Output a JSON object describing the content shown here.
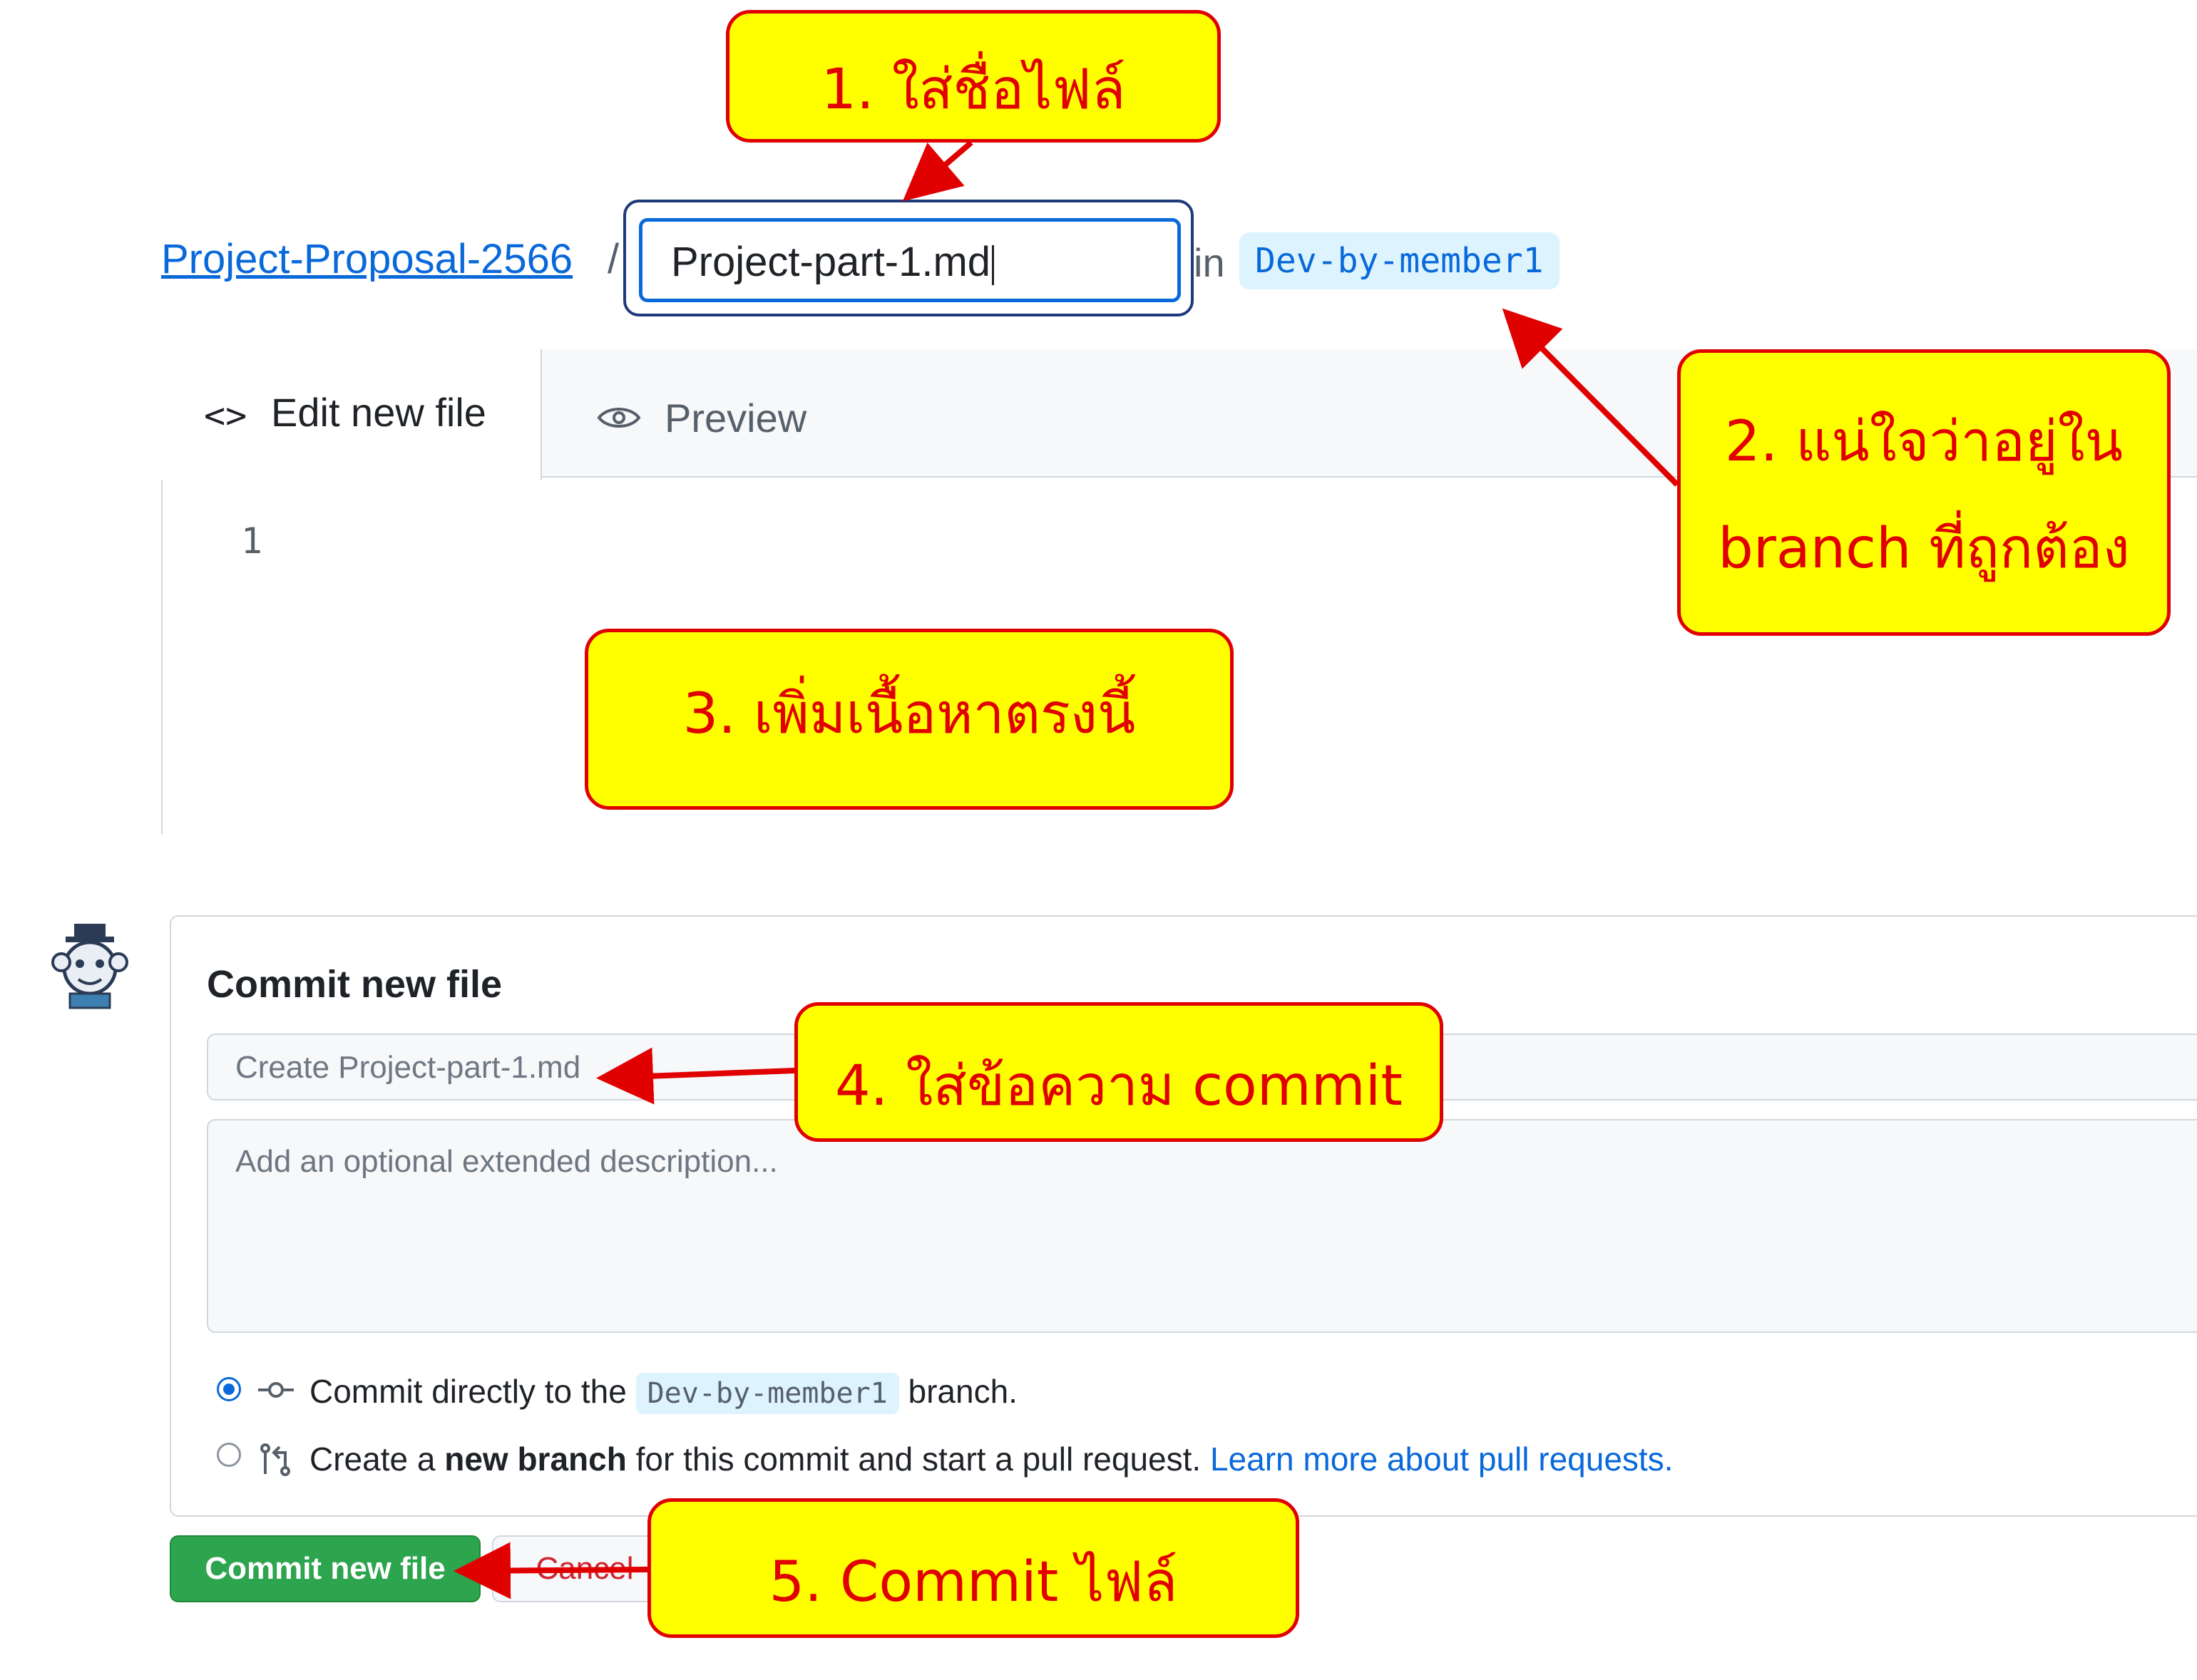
{
  "breadcrumb": {
    "repo": "Project-Proposal-2566",
    "separator": "/",
    "filename_value": "Project-part-1.md",
    "in_label": "in",
    "branch": "Dev-by-member1"
  },
  "editor": {
    "tab_edit_label": "Edit new file",
    "tab_preview_label": "Preview",
    "line_number": "1",
    "icons": [
      "code-icon",
      "eye-icon"
    ]
  },
  "commit": {
    "title": "Commit new file",
    "message_placeholder": "Create Project-part-1.md",
    "description_placeholder": "Add an optional extended description...",
    "option_direct": {
      "prefix": "Commit directly to the",
      "branch": "Dev-by-member1",
      "suffix": "branch.",
      "selected": true
    },
    "option_new_branch": {
      "prefix": "Create a",
      "bold": "new branch",
      "suffix": "for this commit and start a pull request.",
      "link": "Learn more about pull requests.",
      "selected": false
    },
    "commit_button": "Commit new file",
    "cancel_button": "Cancel"
  },
  "annotations": {
    "step1": "1. ใส่ชื่อไฟล์",
    "step2_line1": "2. แน่ใจว่าอยู่ใน",
    "step2_line2": "branch ที่ถูกต้อง",
    "step3": "3. เพิ่มเนื้อหาตรงนี้",
    "step4": "4. ใส่ข้อความ commit",
    "step5": "5. Commit ไฟล์"
  },
  "colors": {
    "link": "#0969da",
    "commit_button": "#2da44e",
    "callout_fill": "#ffff00",
    "callout_border": "#e00000"
  }
}
